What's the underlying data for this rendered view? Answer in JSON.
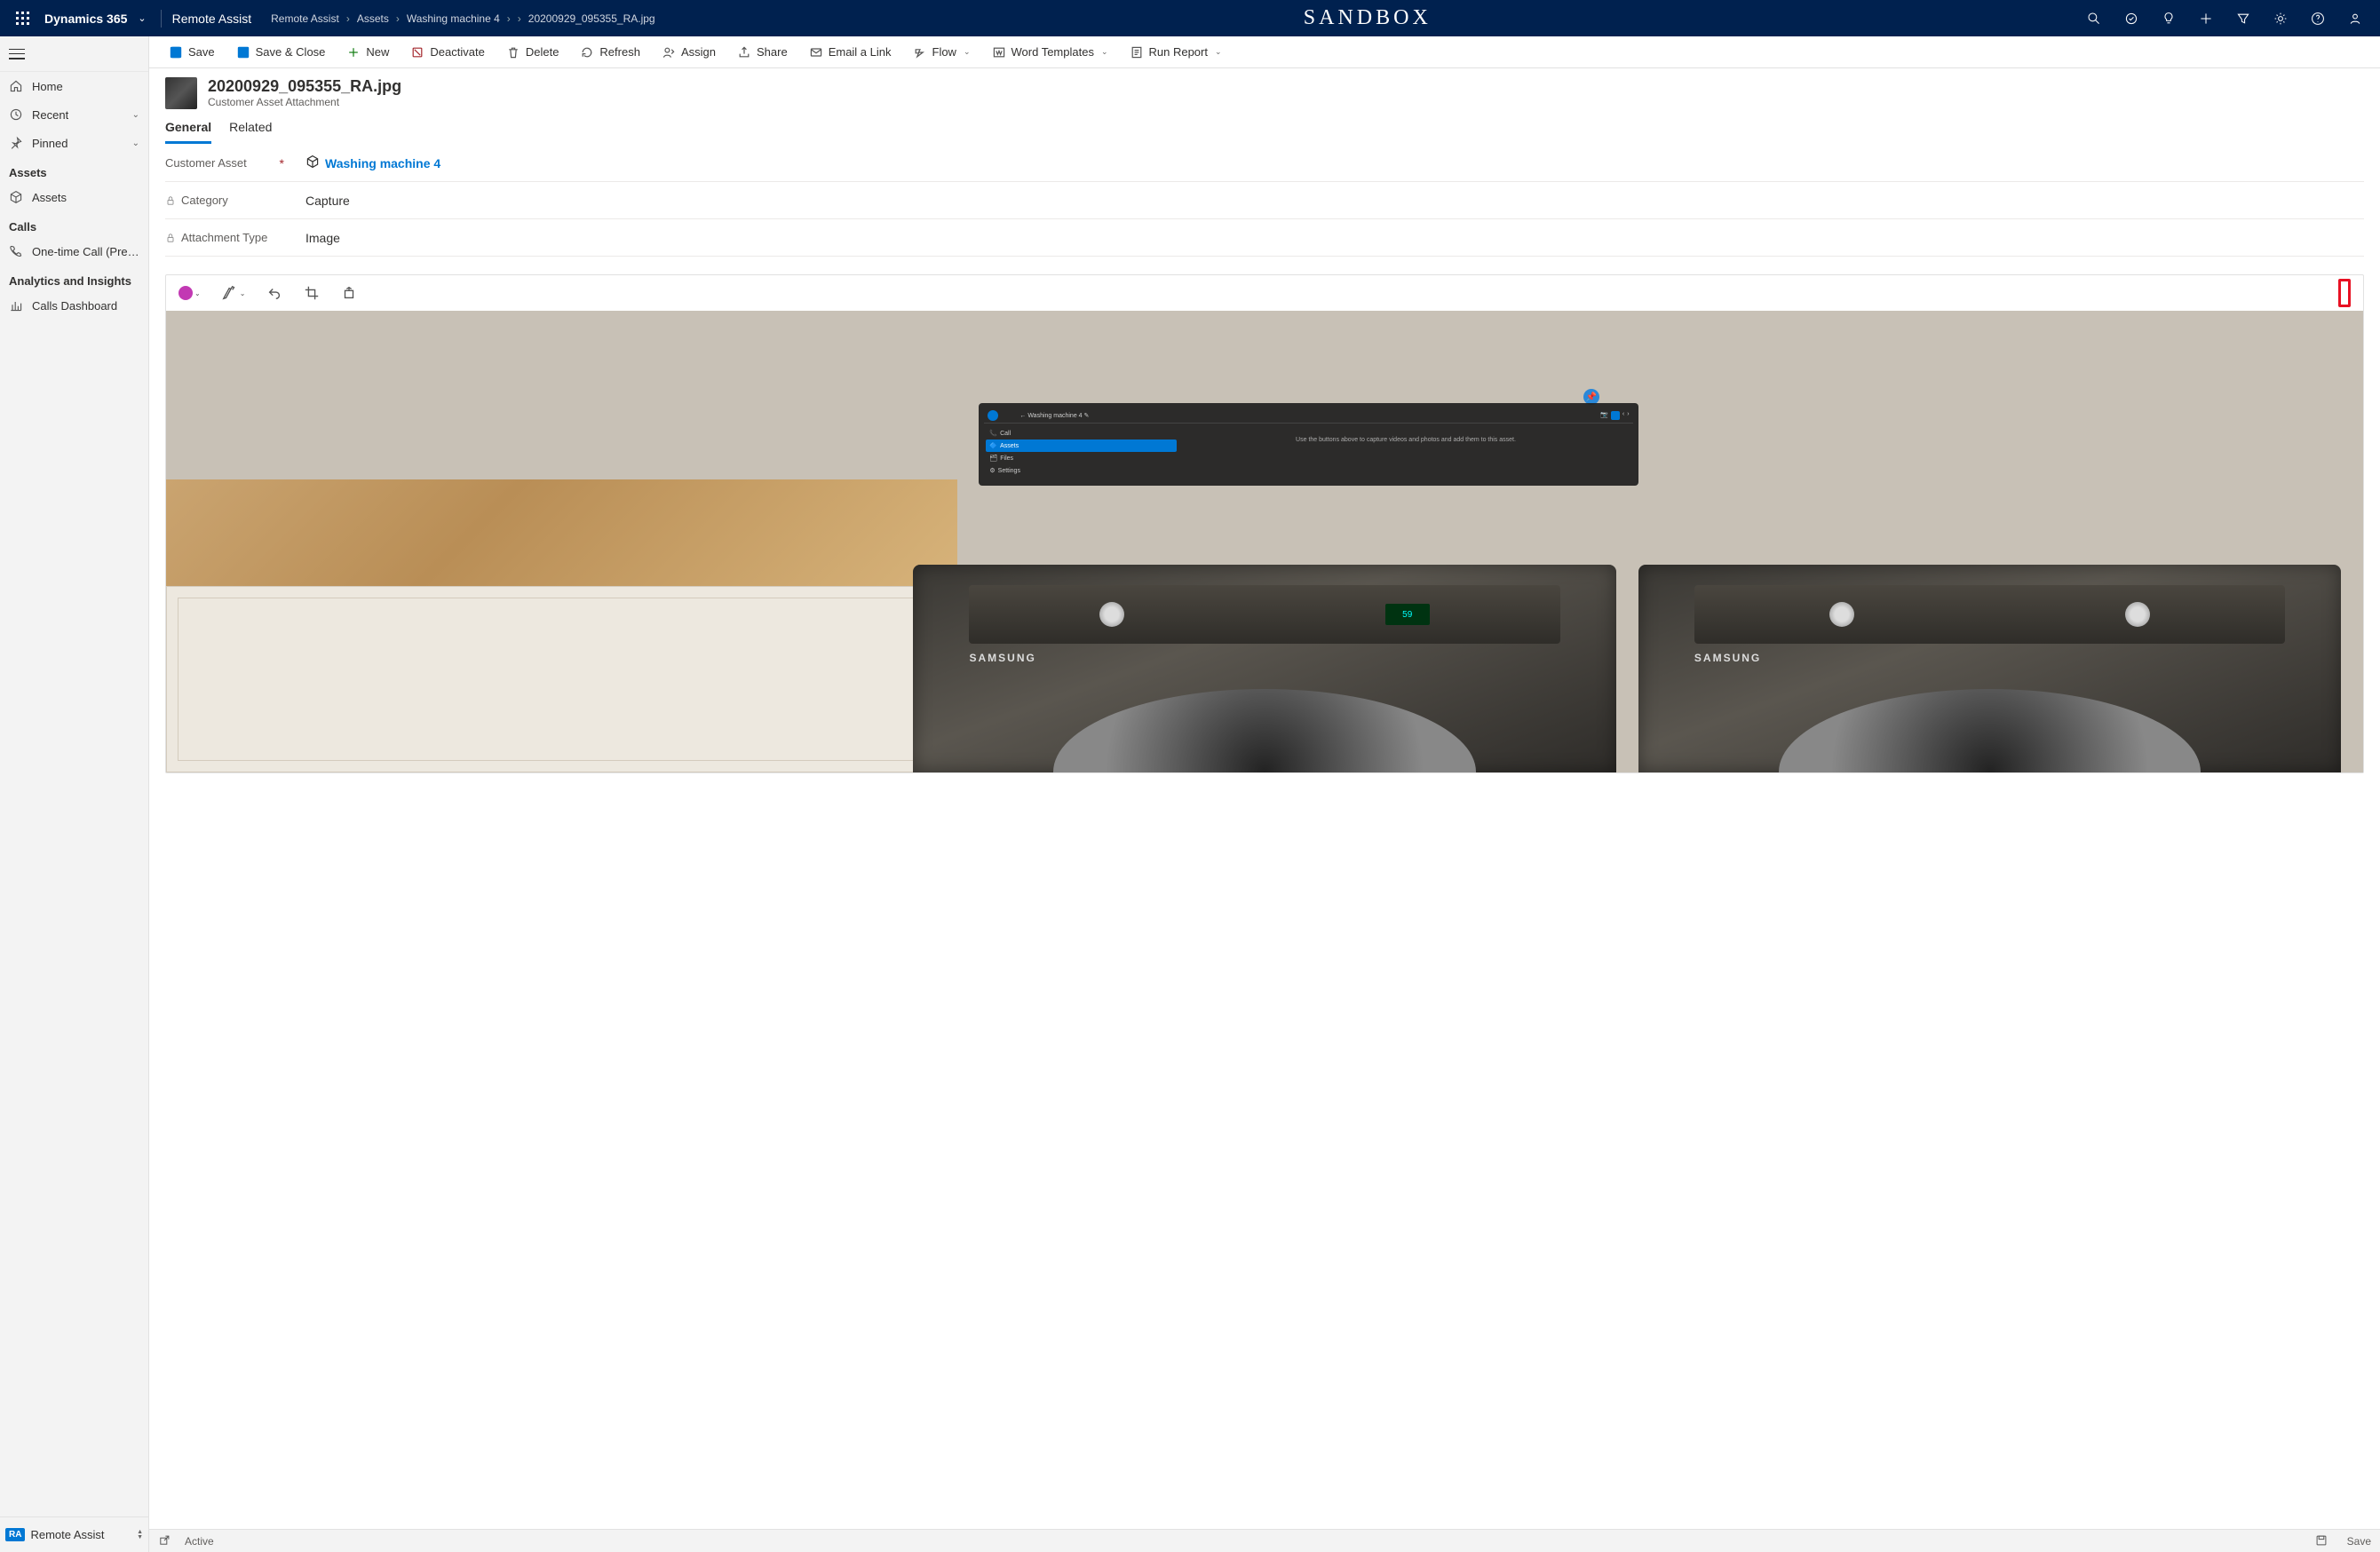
{
  "topbar": {
    "brand": "Dynamics 365",
    "app": "Remote Assist",
    "env": "SANDBOX"
  },
  "breadcrumb": {
    "items": [
      "Remote Assist",
      "Assets",
      "Washing machine 4",
      "20200929_095355_RA.jpg"
    ]
  },
  "commands": {
    "save": "Save",
    "save_close": "Save & Close",
    "new": "New",
    "deactivate": "Deactivate",
    "delete": "Delete",
    "refresh": "Refresh",
    "assign": "Assign",
    "share": "Share",
    "email_link": "Email a Link",
    "flow": "Flow",
    "word_templates": "Word Templates",
    "run_report": "Run Report"
  },
  "sidebar": {
    "home": "Home",
    "recent": "Recent",
    "pinned": "Pinned",
    "groups": {
      "assets": {
        "header": "Assets",
        "item": "Assets"
      },
      "calls": {
        "header": "Calls",
        "item": "One-time Call (Previ…"
      },
      "analytics": {
        "header": "Analytics and Insights",
        "item": "Calls Dashboard"
      }
    },
    "bottom": {
      "badge": "RA",
      "label": "Remote Assist"
    }
  },
  "record": {
    "title": "20200929_095355_RA.jpg",
    "subtitle": "Customer Asset Attachment"
  },
  "tabs": {
    "general": "General",
    "related": "Related"
  },
  "fields": {
    "customer_asset": {
      "label": "Customer Asset",
      "value": "Washing machine 4"
    },
    "category": {
      "label": "Category",
      "value": "Capture"
    },
    "attachment_type": {
      "label": "Attachment Type",
      "value": "Image"
    }
  },
  "holo": {
    "title": "Washing machine 4",
    "side": {
      "call": "Call",
      "assets": "Assets",
      "files": "Files",
      "settings": "Settings"
    },
    "msg": "Use the buttons above to capture videos and photos and add them to this asset."
  },
  "machine": {
    "brand": "SAMSUNG",
    "display": "59"
  },
  "status": {
    "state": "Active",
    "save": "Save"
  }
}
